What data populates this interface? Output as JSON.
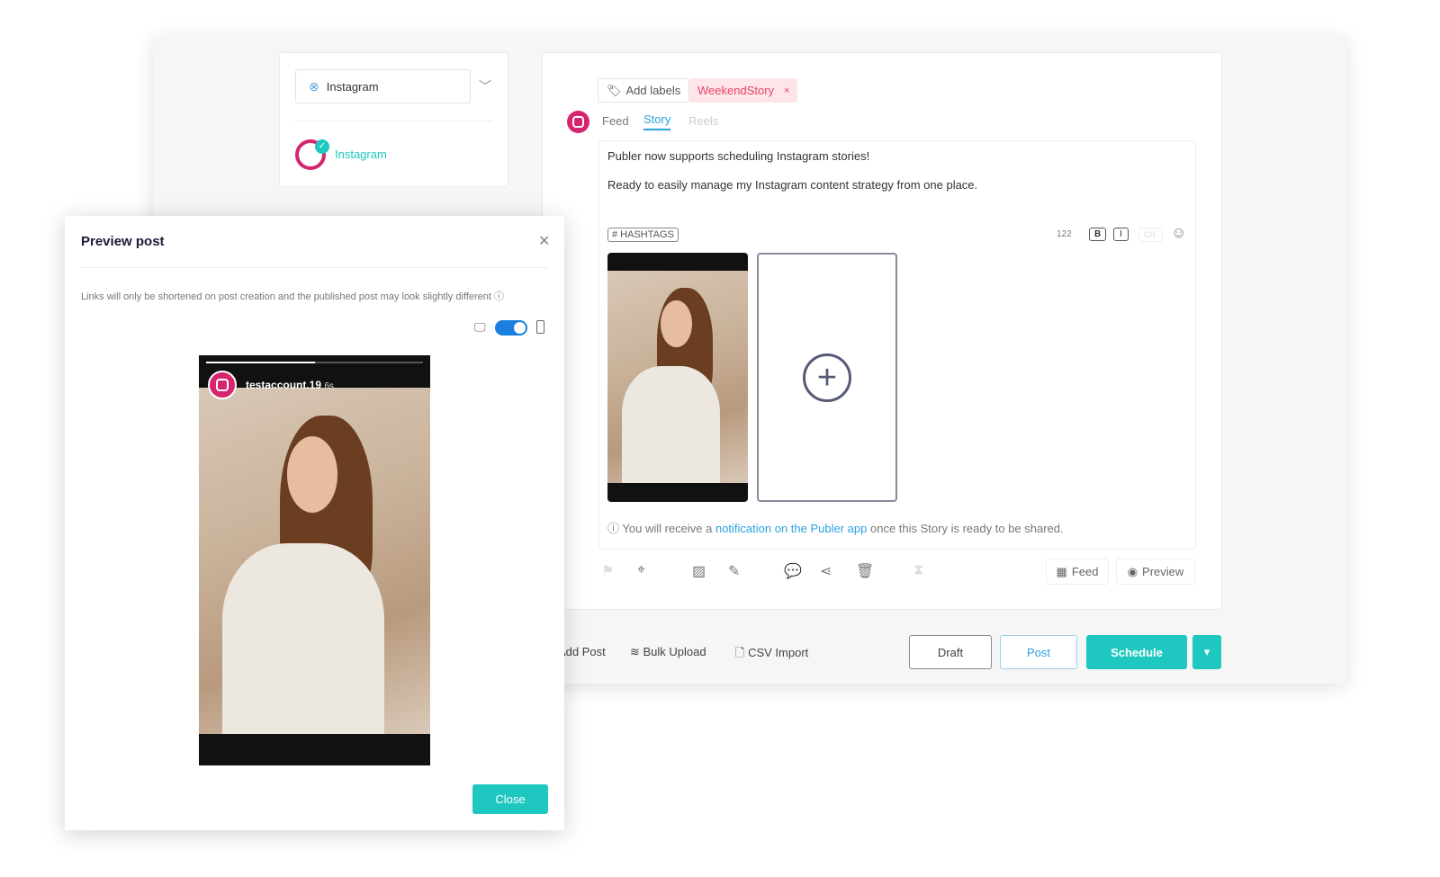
{
  "account_selector": {
    "value": "Instagram",
    "account_name": "Instagram"
  },
  "editor": {
    "add_labels": "Add labels",
    "label_tag": "WeekendStory",
    "label_remove": "×",
    "tabs": [
      {
        "label": "Feed"
      },
      {
        "label": "Story",
        "active": true
      },
      {
        "label": "Reels"
      }
    ],
    "text_line1": "Publer now supports scheduling Instagram stories!",
    "text_line2": "Ready to easily manage my Instagram content strategy from one place.",
    "hashtags": "# HASHTAGS",
    "char_count": "122",
    "bold": "B",
    "italic": "I",
    "gif": "GIF",
    "notice_pre": "You will receive a ",
    "notice_link": "notification on the Publer app",
    "notice_post": " once this Story is ready to be shared.",
    "feed_button": "Feed",
    "preview_button": "Preview"
  },
  "bottom": {
    "add_post": "Add Post",
    "bulk_upload": "Bulk Upload",
    "csv_import": "CSV Import",
    "draft": "Draft",
    "post": "Post",
    "schedule": "Schedule"
  },
  "modal": {
    "title": "Preview post",
    "note": "Links will only be shortened on post creation and the published post may look slightly different",
    "username": "testaccount.19",
    "time": "6s",
    "close": "Close",
    "story_progress": 0.5,
    "mobile_view": true
  },
  "colors": {
    "accent": "#1ec8c0",
    "tab_blue": "#2aa1e0",
    "label_pink": "#e8436a",
    "instagram": "#d6246e",
    "toggle": "#1a7fe0"
  }
}
